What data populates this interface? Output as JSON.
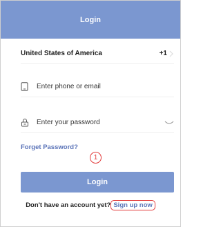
{
  "header": {
    "title": "Login"
  },
  "country": {
    "name": "United States of America",
    "code": "+1",
    "icon": "chevron-right-icon"
  },
  "phone": {
    "placeholder": "Enter phone or email",
    "icon": "phone-icon"
  },
  "password": {
    "placeholder": "Enter your password",
    "icon": "lock-icon",
    "toggle_icon": "eye-closed-icon"
  },
  "links": {
    "forget_password": "Forget Password?"
  },
  "annotation": {
    "marker": "1"
  },
  "login_button": {
    "label": "Login"
  },
  "signup": {
    "prompt": "Don't have an account yet?",
    "link": "Sign up now"
  },
  "colors": {
    "accent": "#7b97d0",
    "link": "#5a73b8",
    "annotation": "#e23a3a"
  }
}
